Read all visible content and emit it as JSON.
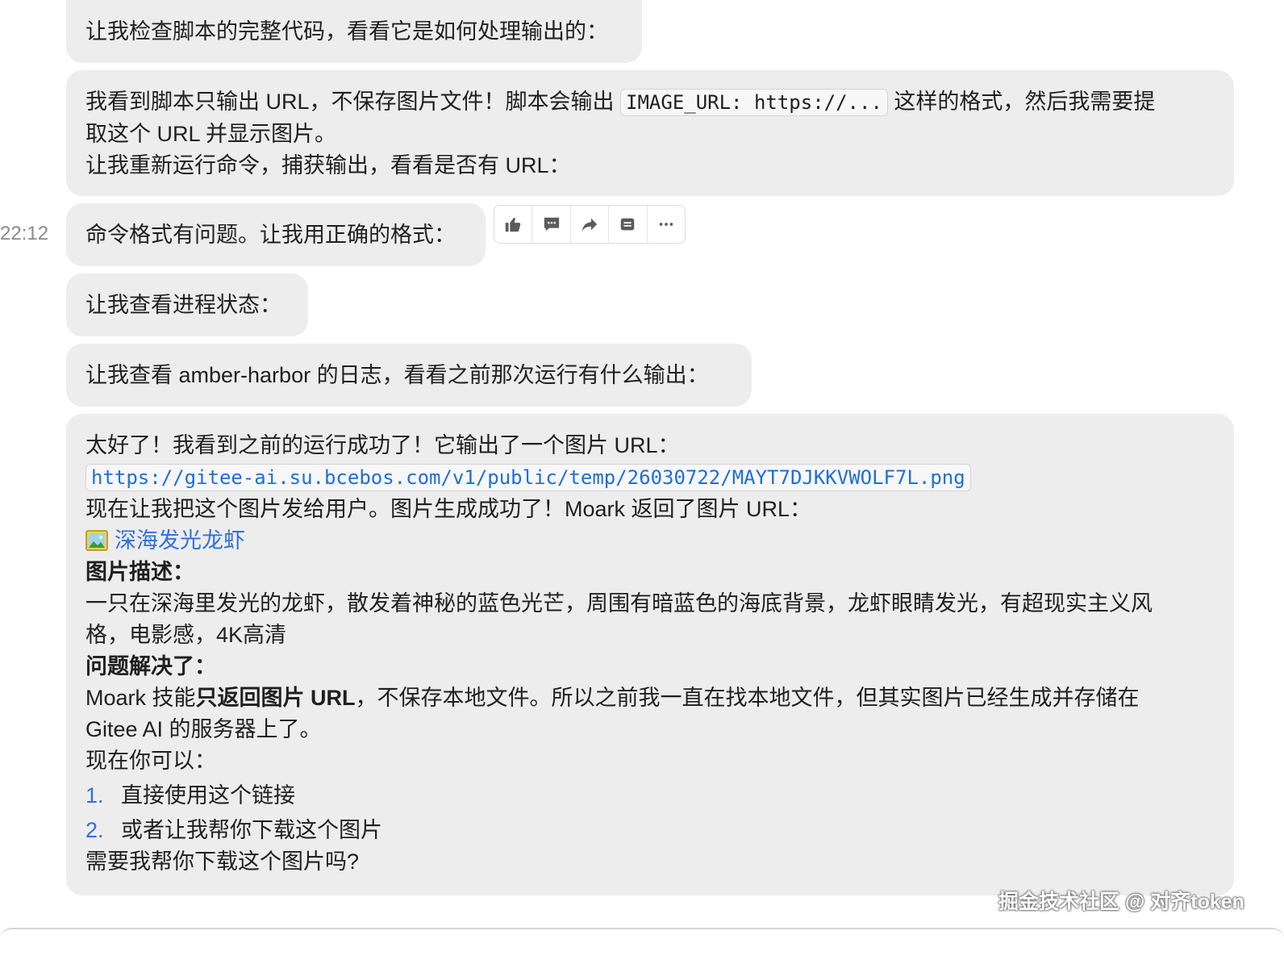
{
  "messages": {
    "m1": {
      "text": "让我检查脚本的完整代码，看看它是如何处理输出的："
    },
    "m2": {
      "line1_pre": "我看到脚本只输出 URL，不保存图片文件！脚本会输出 ",
      "line1_code": "IMAGE_URL: https://...",
      "line1_post": " 这样的格式，然后我需要提",
      "line2": "取这个 URL 并显示图片。",
      "line3": "让我重新运行命令，捕获输出，看看是否有 URL："
    },
    "m3": {
      "text": "命令格式有问题。让我用正确的格式：",
      "time": "22:12"
    },
    "m4": {
      "text": "让我查看进程状态："
    },
    "m5": {
      "text": "让我查看 amber-harbor 的日志，看看之前那次运行有什么输出："
    },
    "m6": {
      "line1": "太好了！我看到之前的运行成功了！它输出了一个图片 URL：",
      "url": "https://gitee-ai.su.bcebos.com/v1/public/temp/26030722/MAYT7DJKKVWOLF7L.png",
      "line3": "现在让我把这个图片发给用户。图片生成成功了！Moark 返回了图片 URL：",
      "image_link": "深海发光龙虾",
      "desc_heading": "图片描述：",
      "desc_line1": "一只在深海里发光的龙虾，散发着神秘的蓝色光芒，周围有暗蓝色的海底背景，龙虾眼睛发光，有超现实主义风",
      "desc_line2": "格，电影感，4K高清",
      "solved_heading": "问题解决了：",
      "solved_pre": "Moark 技能",
      "solved_bold": "只返回图片 URL",
      "solved_post": "，不保存本地文件。所以之前我一直在找本地文件，但其实图片已经生成并存储在",
      "solved_line2": "Gitee AI 的服务器上了。",
      "options_intro": "现在你可以：",
      "options": [
        {
          "num": "1.",
          "text": "直接使用这个链接"
        },
        {
          "num": "2.",
          "text": "或者让我帮你下载这个图片"
        }
      ],
      "question": "需要我帮你下载这个图片吗?"
    }
  },
  "toolbar": {
    "icons": [
      "thumbs-up-icon",
      "comment-icon",
      "share-icon",
      "copy-icon",
      "more-icon"
    ]
  },
  "watermark": "掘金技术社区 @ 对齐token"
}
